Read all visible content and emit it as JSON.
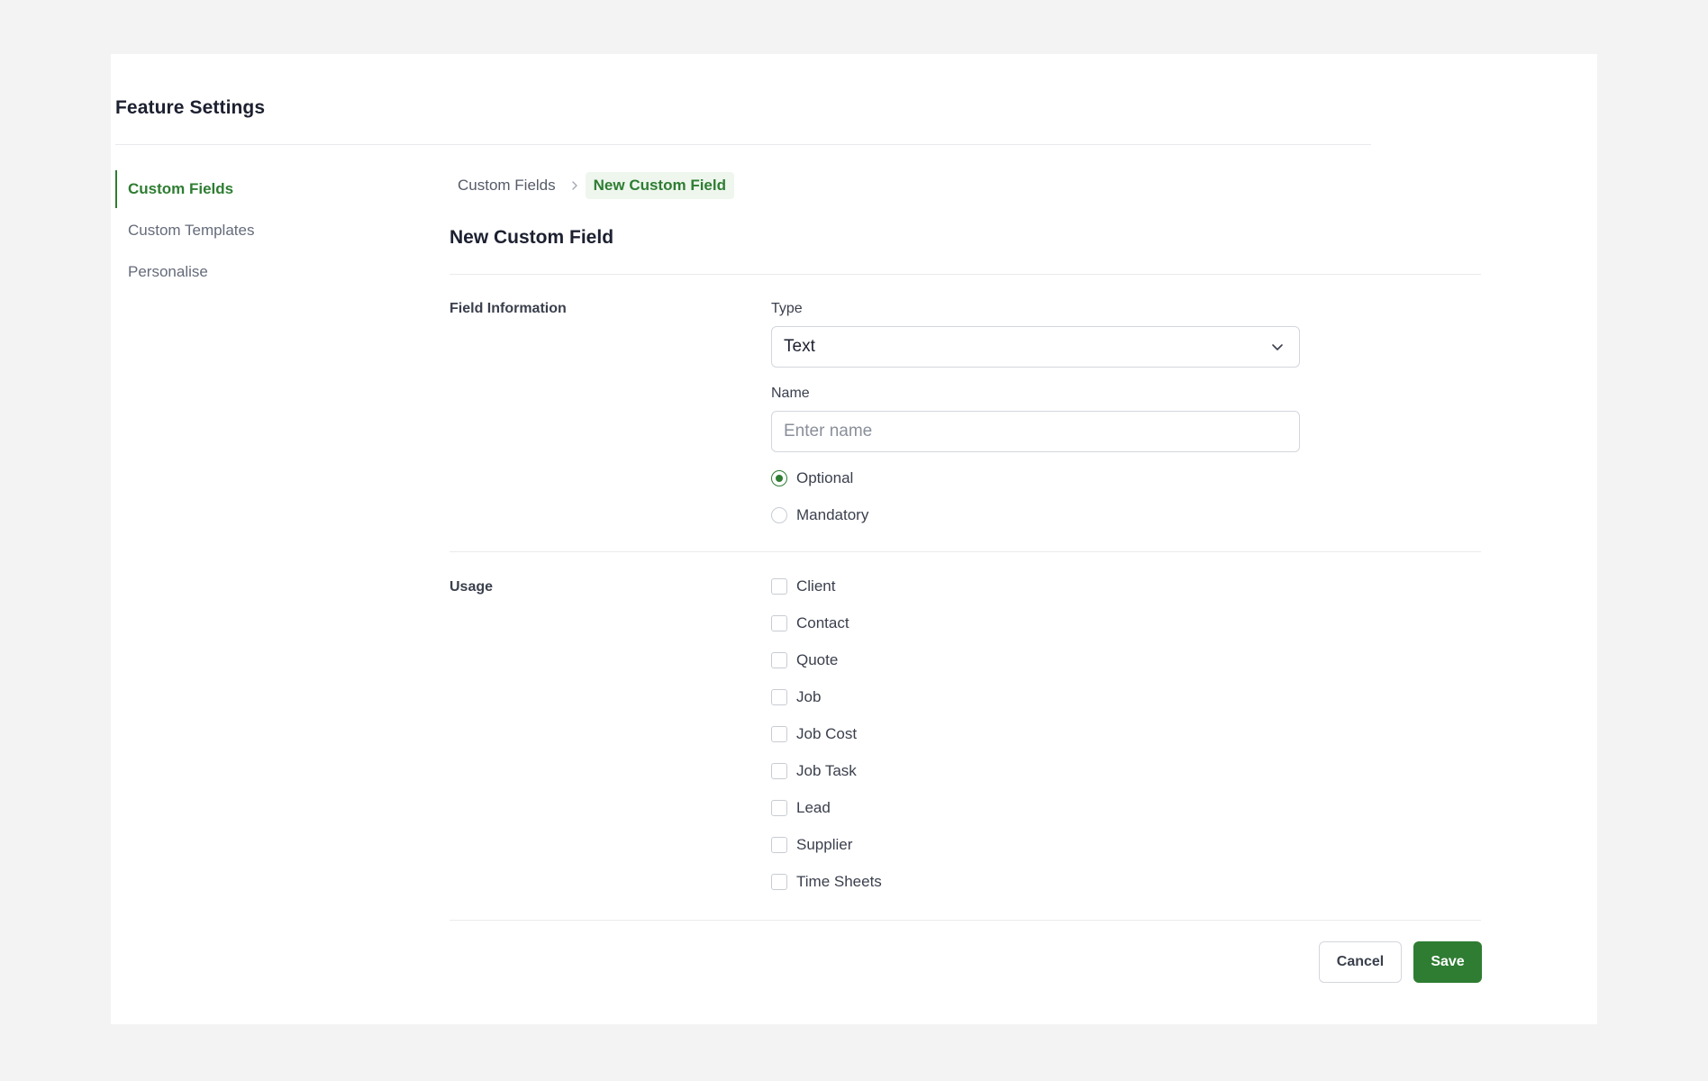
{
  "header": {
    "title": "Feature Settings"
  },
  "sidebar": {
    "items": [
      {
        "label": "Custom Fields",
        "active": true
      },
      {
        "label": "Custom Templates",
        "active": false
      },
      {
        "label": "Personalise",
        "active": false
      }
    ]
  },
  "breadcrumb": {
    "parent": "Custom Fields",
    "current": "New Custom Field"
  },
  "form": {
    "title": "New Custom Field",
    "field_info": {
      "section_label": "Field Information",
      "type_label": "Type",
      "type_value": "Text",
      "name_label": "Name",
      "name_value": "",
      "name_placeholder": "Enter name",
      "requirement_options": [
        "Optional",
        "Mandatory"
      ],
      "requirement_selected": "Optional"
    },
    "usage": {
      "section_label": "Usage",
      "options": [
        "Client",
        "Contact",
        "Quote",
        "Job",
        "Job Cost",
        "Job Task",
        "Lead",
        "Supplier",
        "Time Sheets"
      ],
      "checked": []
    }
  },
  "actions": {
    "cancel_label": "Cancel",
    "save_label": "Save"
  },
  "colors": {
    "accent": "#2e7d32",
    "background": "#f3f3f3"
  }
}
